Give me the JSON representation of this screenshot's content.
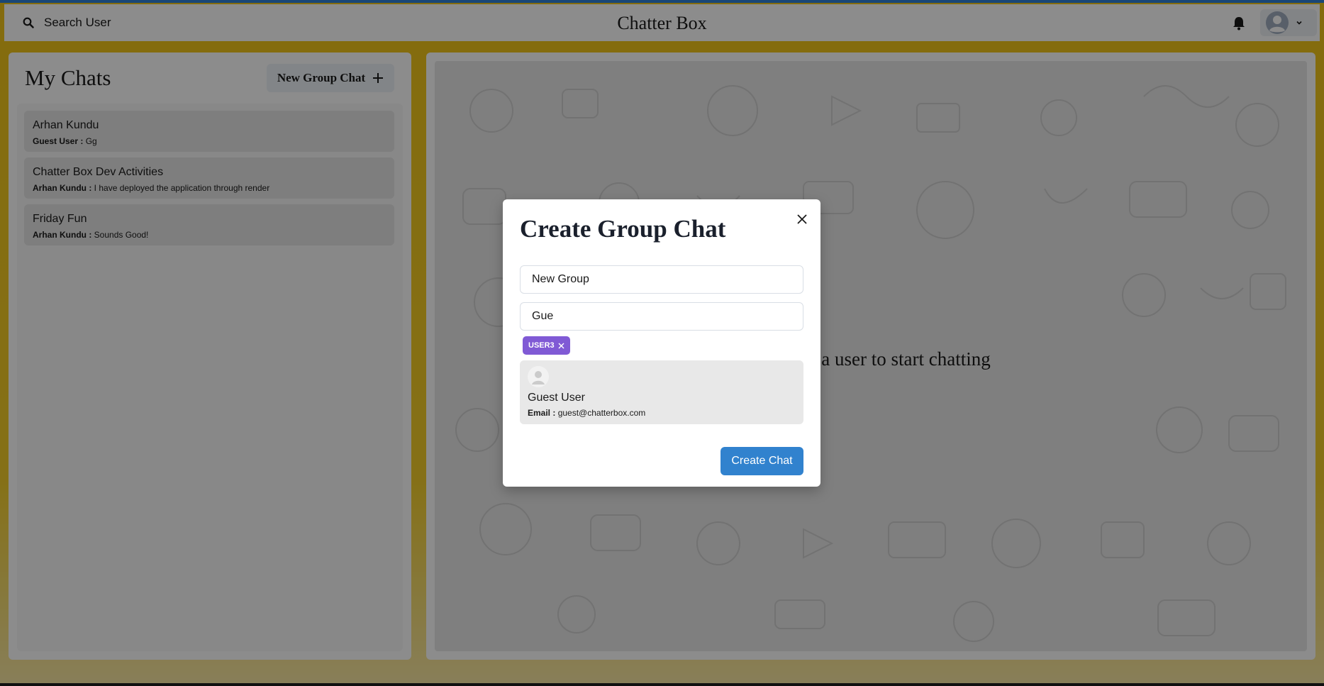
{
  "header": {
    "search_label": "Search User",
    "app_title": "Chatter Box"
  },
  "sidebar": {
    "title": "My Chats",
    "new_group_label": "New Group Chat",
    "chats": [
      {
        "name": "Arhan Kundu",
        "sender": "Guest User :",
        "message": "Gg"
      },
      {
        "name": "Chatter Box Dev Activities",
        "sender": "Arhan Kundu :",
        "message": "I have deployed the application through render"
      },
      {
        "name": "Friday Fun",
        "sender": "Arhan Kundu :",
        "message": "Sounds Good!"
      }
    ]
  },
  "main": {
    "empty_message": "Click on a user to start chatting"
  },
  "modal": {
    "title": "Create Group Chat",
    "group_name_value": "New Group",
    "search_value": "Gue",
    "selected_tags": [
      "USER3"
    ],
    "search_results": [
      {
        "name": "Guest User",
        "email_label": "Email :",
        "email": "guest@chatterbox.com"
      }
    ],
    "create_label": "Create Chat"
  },
  "colors": {
    "accent_blue": "#3182ce",
    "tag_purple": "#805ad5",
    "background_yellow": "#f0c419"
  }
}
